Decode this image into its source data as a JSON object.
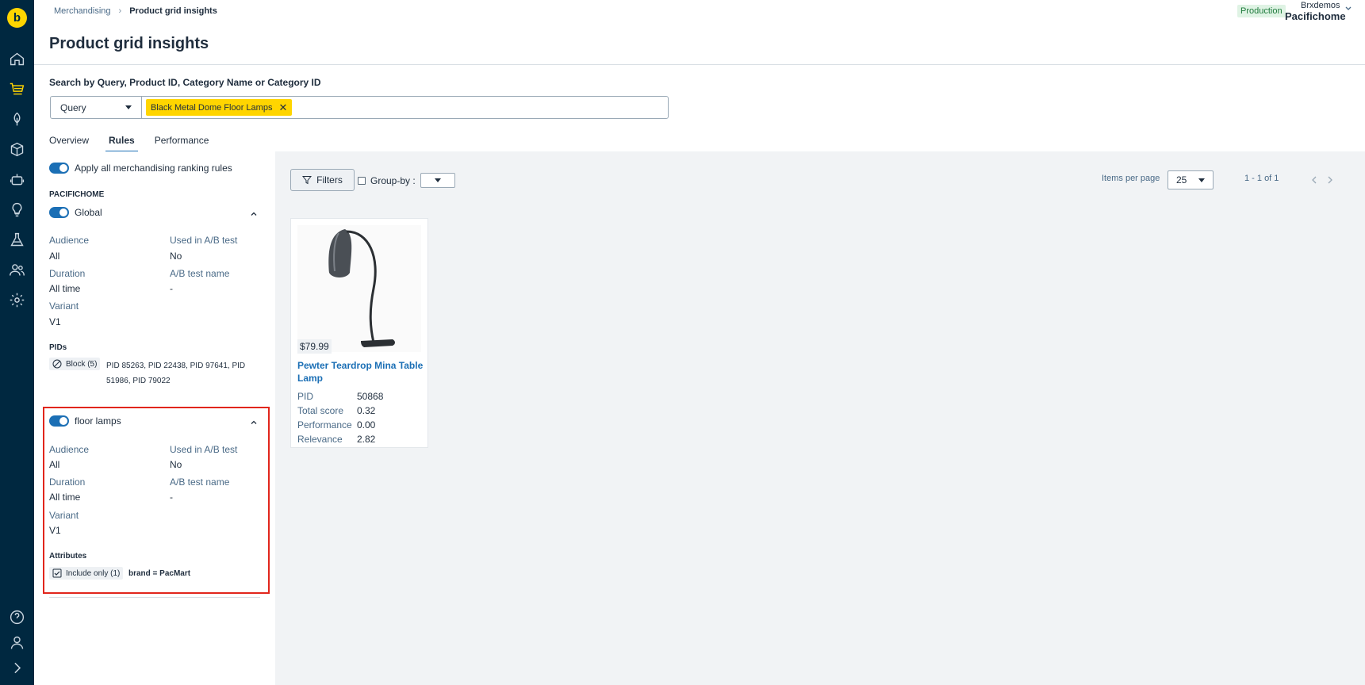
{
  "app": {
    "logo_letter": "b"
  },
  "breadcrumb": {
    "parent": "Merchandising",
    "separator": "›",
    "current": "Product grid insights"
  },
  "header": {
    "environment": "Production",
    "account_name": "Brxdemos",
    "site_name": "Pacifichome"
  },
  "page": {
    "title": "Product grid insights"
  },
  "search": {
    "label": "Search by Query, Product ID, Category Name or Category ID",
    "type_selected": "Query",
    "chip": "Black Metal Dome Floor Lamps",
    "chip_remove": "✕"
  },
  "tabs": [
    {
      "label": "Overview",
      "active": false
    },
    {
      "label": "Rules",
      "active": true
    },
    {
      "label": "Performance",
      "active": false
    }
  ],
  "rules": {
    "apply_all_label": "Apply all merchandising ranking rules",
    "site_heading": "PACIFICHOME",
    "global": {
      "name": "Global",
      "audience_label": "Audience",
      "audience_value": "All",
      "ab_used_label": "Used in A/B test",
      "ab_used_value": "No",
      "duration_label": "Duration",
      "duration_value": "All time",
      "ab_name_label": "A/B test name",
      "ab_name_value": "-",
      "variant_label": "Variant",
      "variant_value": "V1",
      "pids_heading": "PIDs",
      "pids_tag": "Block (5)",
      "pids_list": "PID 85263, PID 22438, PID 97641, PID 51986, PID 79022"
    },
    "floor_lamps": {
      "name": "floor lamps",
      "audience_label": "Audience",
      "audience_value": "All",
      "ab_used_label": "Used in A/B test",
      "ab_used_value": "No",
      "duration_label": "Duration",
      "duration_value": "All time",
      "ab_name_label": "A/B test name",
      "ab_name_value": "-",
      "variant_label": "Variant",
      "variant_value": "V1",
      "attributes_heading": "Attributes",
      "attr_tag": "Include only (1)",
      "attr_rule": "brand = PacMart"
    }
  },
  "results": {
    "filters_label": "Filters",
    "groupby_label": "Group-by :",
    "items_per_page_label": "Items per page",
    "items_per_page_value": "25",
    "pager_text": "1 - 1 of 1"
  },
  "product": {
    "price": "$79.99",
    "name": "Pewter Teardrop Mina Table Lamp",
    "pid_label": "PID",
    "pid_value": "50868",
    "total_score_label": "Total score",
    "total_score_value": "0.32",
    "performance_label": "Performance",
    "performance_value": "0.00",
    "relevance_label": "Relevance",
    "relevance_value": "2.82"
  },
  "colors": {
    "sidebar": "#002840",
    "accent": "#1b6fb5",
    "chip": "#ffd500",
    "highlight": "#e1261c"
  },
  "icons": [
    "home-icon",
    "cart-icon",
    "leaf-icon",
    "cube-icon",
    "robot-icon",
    "lightbulb-icon",
    "flask-icon",
    "users-icon",
    "gear-icon",
    "help-icon",
    "user-icon",
    "expand-icon"
  ]
}
